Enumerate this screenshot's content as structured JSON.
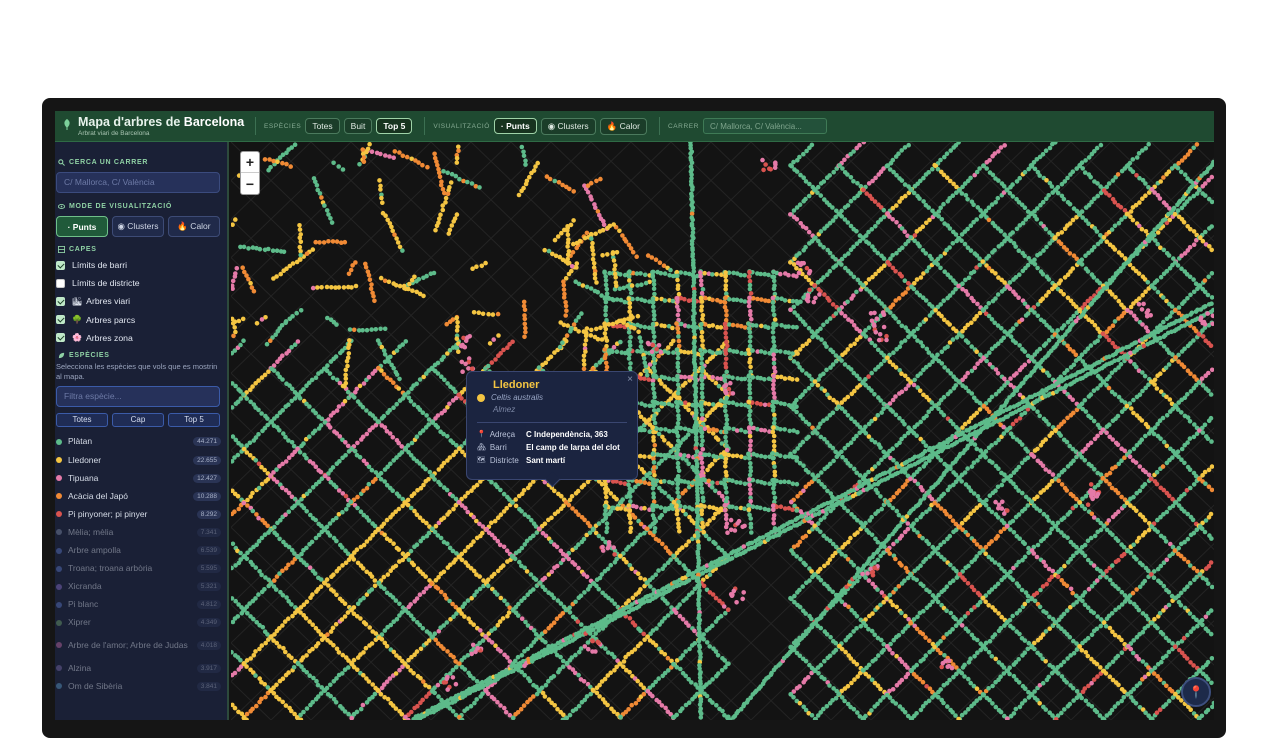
{
  "header": {
    "title_prefix": "Mapa d'arbres de ",
    "title_city": "Barcelona",
    "subtitle": "Arbrat viari de Barcelona",
    "species_label": "ESPÈCIES",
    "species_buttons": [
      "Totes",
      "Buit",
      "Top 5"
    ],
    "species_active": "Top 5",
    "view_label": "VISUALITZACIÓ",
    "view_buttons": [
      "· Punts",
      "◉ Clusters",
      "🔥 Calor"
    ],
    "view_active": "· Punts",
    "street_label": "CARRER",
    "street_placeholder": "C/ Mallorca, C/ València..."
  },
  "sidebar": {
    "search_title": "CERCA UN CARRER",
    "search_placeholder": "C/ Mallorca, C/ València",
    "mode_title": "MODE DE VISUALITZACIÓ",
    "modes": [
      "· Punts",
      "◉ Clusters",
      "🔥 Calor"
    ],
    "layers_title": "CAPES",
    "layers": [
      {
        "label": "Límits de barri",
        "checked": true,
        "icon": ""
      },
      {
        "label": "Límits de districte",
        "checked": false,
        "icon": ""
      },
      {
        "label": "Arbres viari",
        "checked": true,
        "icon": "🏙"
      },
      {
        "label": "Arbres parcs",
        "checked": true,
        "icon": "🌳"
      },
      {
        "label": "Arbres zona",
        "checked": true,
        "icon": "🌸"
      }
    ],
    "species_title": "ESPÈCIES",
    "species_hint": "Selecciona les espècies que vols que es mostrin al mapa.",
    "filter_placeholder": "Filtra espècie...",
    "filter_buttons": [
      "Totes",
      "Cap",
      "Top 5"
    ],
    "species": [
      {
        "name": "Plàtan",
        "count": "44.271",
        "color": "#5dbb8a",
        "active": true
      },
      {
        "name": "Lledoner",
        "count": "22.655",
        "color": "#f4c542",
        "active": true
      },
      {
        "name": "Tipuana",
        "count": "12.427",
        "color": "#e57aa8",
        "active": true
      },
      {
        "name": "Acàcia del Japó",
        "count": "10.288",
        "color": "#f08a35",
        "active": true
      },
      {
        "name": "Pi pinyoner; pi pinyer",
        "count": "8.292",
        "color": "#d9534f",
        "active": true
      },
      {
        "name": "Mèlia; mèlia",
        "count": "7.341",
        "color": "#7f8ca8",
        "active": false
      },
      {
        "name": "Arbre ampolla",
        "count": "6.539",
        "color": "#5b77c6",
        "active": false
      },
      {
        "name": "Troana; troana arbòria",
        "count": "5.595",
        "color": "#5b77c6",
        "active": false
      },
      {
        "name": "Xicranda",
        "count": "5.321",
        "color": "#8a6fc9",
        "active": false
      },
      {
        "name": "Pi blanc",
        "count": "4.812",
        "color": "#5b77c6",
        "active": false
      },
      {
        "name": "Xiprer",
        "count": "4.349",
        "color": "#6fa36f",
        "active": false
      },
      {
        "name": "Arbre de l'amor; Arbre de Judas",
        "count": "4.018",
        "color": "#c26aa6",
        "active": false
      },
      {
        "name": "Alzina",
        "count": "3.917",
        "color": "#7a6aa8",
        "active": false
      },
      {
        "name": "Om de Sibèria",
        "count": "3.841",
        "color": "#5b9ac6",
        "active": false
      }
    ]
  },
  "popup": {
    "name": "Lledoner",
    "scientific": "Celtis australis",
    "common": "Almez",
    "rows": [
      {
        "key": "Adreça",
        "icon": "📍",
        "value": "C Independència, 363"
      },
      {
        "key": "Barri",
        "icon": "🏘",
        "value": "El camp de larpa del clot"
      },
      {
        "key": "Districte",
        "icon": "🗺",
        "value": "Sant martí"
      }
    ],
    "close": "×"
  },
  "map": {
    "zoom_in": "+",
    "zoom_out": "−",
    "locate_icon": "📍",
    "colors": {
      "platan": "#5dbb8a",
      "lledoner": "#f4c542",
      "tipuana": "#e57aa8",
      "acacia": "#f08a35",
      "pi": "#d9534f"
    }
  }
}
